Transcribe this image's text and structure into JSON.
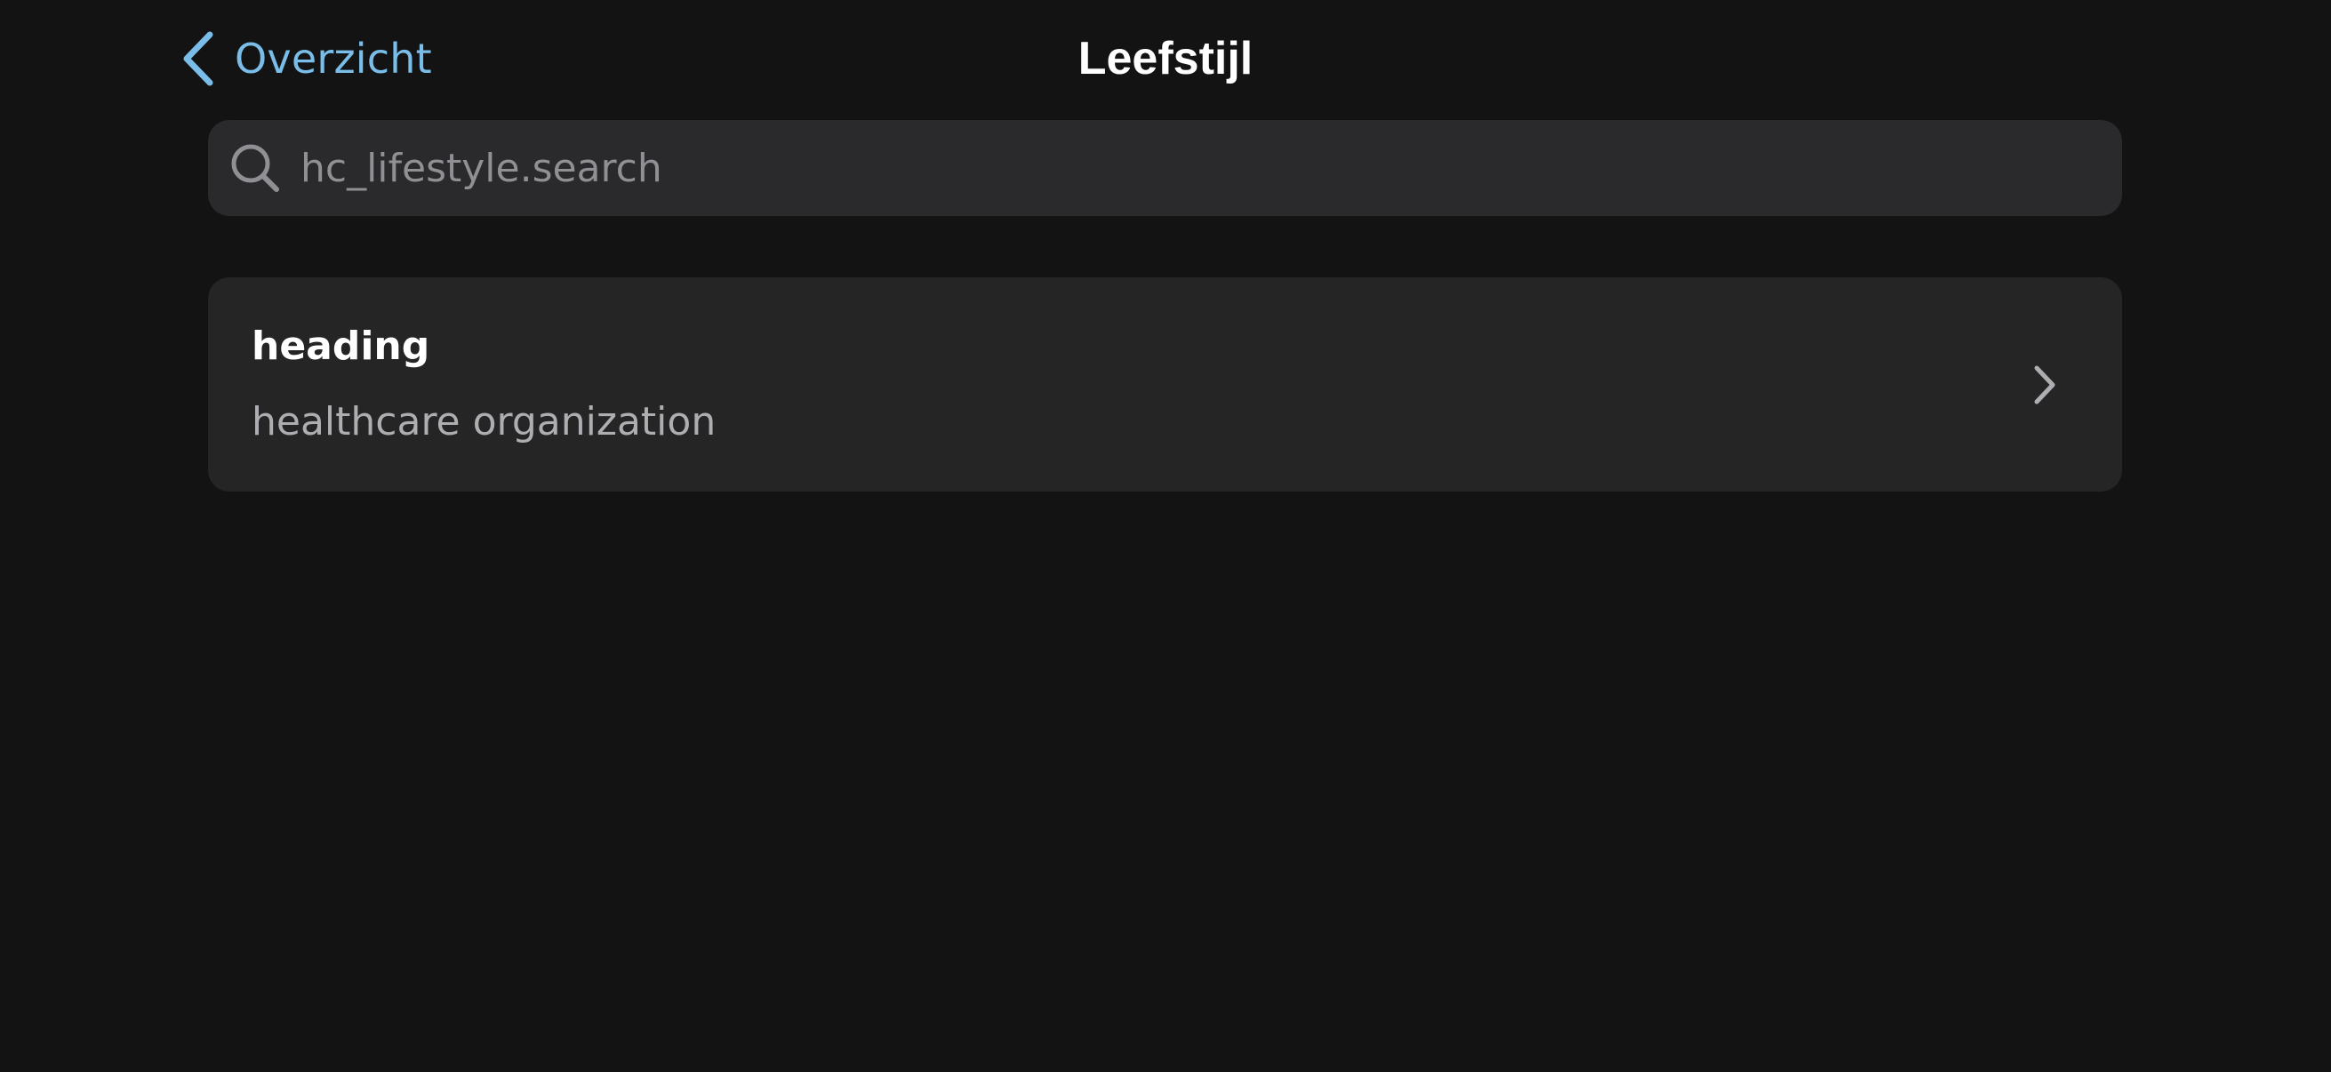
{
  "nav": {
    "back_label": "Overzicht",
    "back_icon": "chevron-left-icon",
    "title": "Leefstijl"
  },
  "search": {
    "placeholder": "hc_lifestyle.search",
    "value": "",
    "icon": "search-icon"
  },
  "list": {
    "items": [
      {
        "heading": "heading",
        "subtitle": "healthcare organization",
        "icon": "chevron-right-icon"
      }
    ]
  },
  "colors": {
    "background": "#131313",
    "accent": "#79bde8",
    "surface": "#2a2a2c",
    "card": "#252525",
    "text_primary": "#ffffff",
    "text_secondary": "#aeaeb2",
    "placeholder": "#8f8f94"
  }
}
